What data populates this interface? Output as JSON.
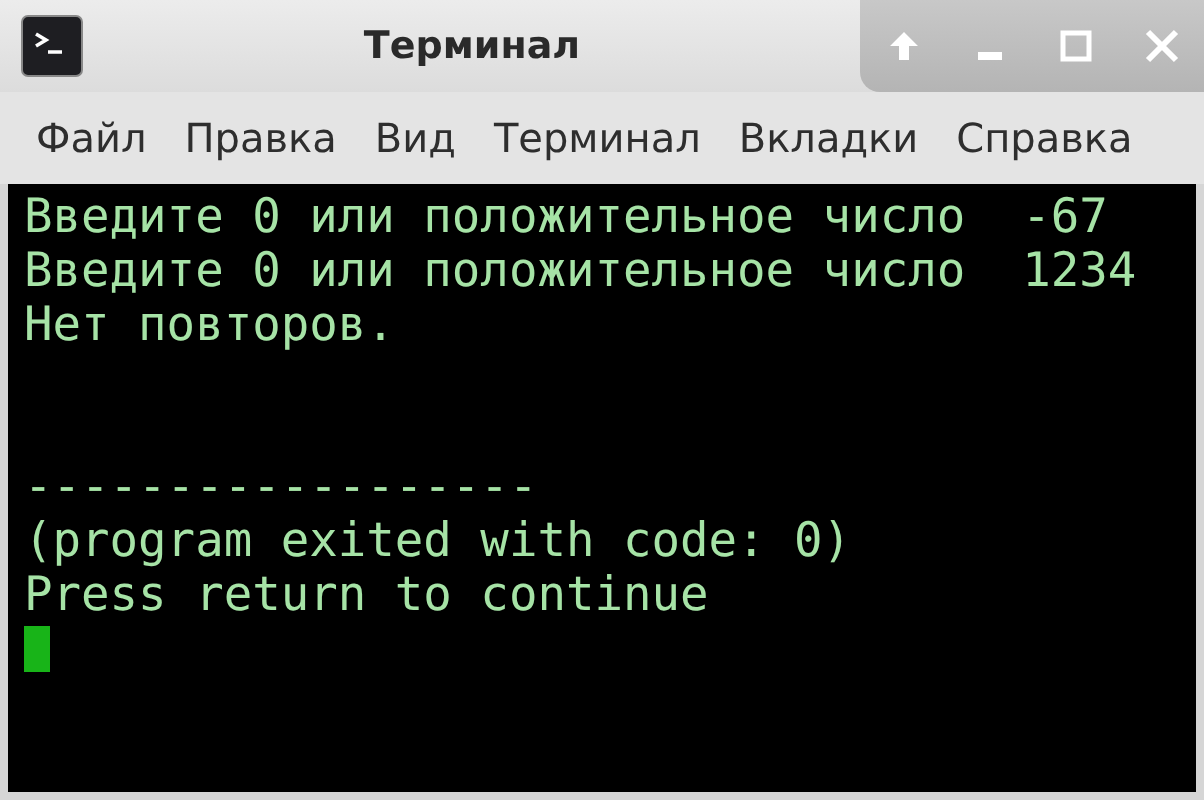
{
  "window": {
    "title": "Терминал"
  },
  "menu": [
    "Файл",
    "Правка",
    "Вид",
    "Терминал",
    "Вкладки",
    "Справка"
  ],
  "terminal": {
    "lines": [
      {
        "kind": "text",
        "text": "Введите 0 или положительное число  -67"
      },
      {
        "kind": "text",
        "text": "Введите 0 или положительное число  1234"
      },
      {
        "kind": "text",
        "text": "Нет повторов."
      },
      {
        "kind": "blank"
      },
      {
        "kind": "blank"
      },
      {
        "kind": "text",
        "text": "------------------"
      },
      {
        "kind": "text",
        "text": "(program exited with code: 0)"
      },
      {
        "kind": "text",
        "text": "Press return to continue"
      },
      {
        "kind": "cursor"
      }
    ]
  }
}
